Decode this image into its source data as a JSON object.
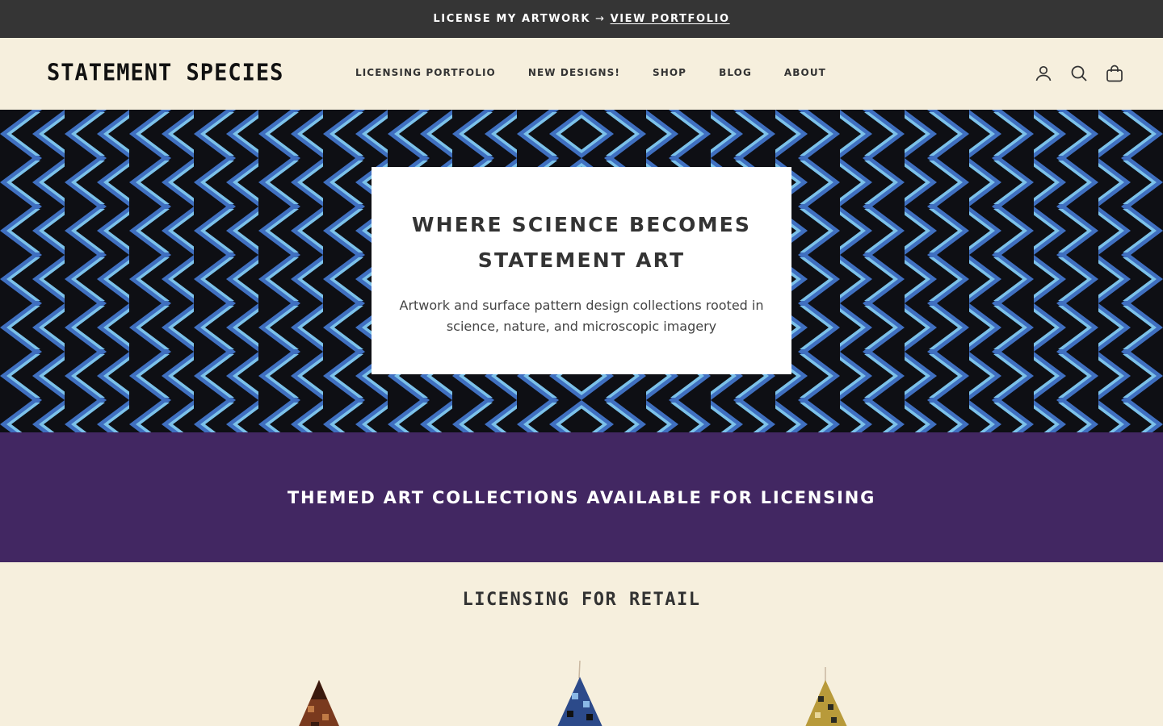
{
  "announcement": {
    "text": "LICENSE MY ARTWORK",
    "arrow": "→",
    "link": "VIEW PORTFOLIO"
  },
  "header": {
    "logo": "STATEMENT SPECIES",
    "nav": [
      {
        "label": "LICENSING PORTFOLIO"
      },
      {
        "label": "NEW DESIGNS!"
      },
      {
        "label": "SHOP"
      },
      {
        "label": "BLOG"
      },
      {
        "label": "ABOUT"
      }
    ],
    "icons": [
      "account-icon",
      "search-icon",
      "cart-icon"
    ]
  },
  "hero": {
    "title_line1": "WHERE SCIENCE BECOMES",
    "title_line2": "STATEMENT ART",
    "text": "Artwork and surface pattern design collections rooted in science, nature, and microscopic imagery",
    "pattern_colors": {
      "light": "#7cc2ea",
      "mid": "#3f6fc0",
      "dark": "#0e0f14"
    }
  },
  "band": {
    "title": "THEMED ART COLLECTIONS AVAILABLE FOR LICENSING",
    "color": "#422762"
  },
  "retail": {
    "title": "LICENSING FOR RETAIL",
    "products": [
      {
        "name": "brown-pattern-ornament",
        "color": "#7a3a1e"
      },
      {
        "name": "blue-pattern-ornament",
        "color": "#2c4a8a"
      },
      {
        "name": "gold-pattern-ornament",
        "color": "#b89a3a"
      }
    ]
  }
}
